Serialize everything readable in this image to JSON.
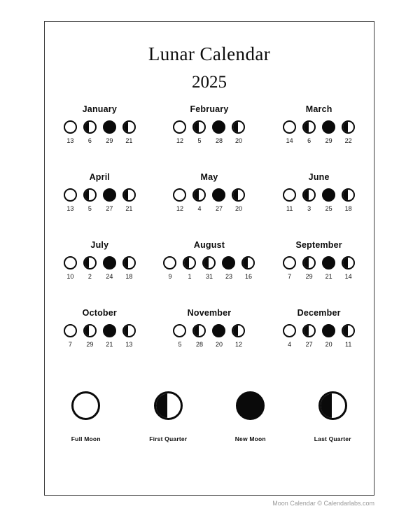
{
  "title": {
    "main": "Lunar Calendar",
    "year": "2025"
  },
  "months": [
    {
      "name": "January",
      "phases": [
        {
          "type": "full",
          "day": "13"
        },
        {
          "type": "first",
          "day": "6"
        },
        {
          "type": "new",
          "day": "29"
        },
        {
          "type": "last",
          "day": "21"
        }
      ]
    },
    {
      "name": "February",
      "phases": [
        {
          "type": "full",
          "day": "12"
        },
        {
          "type": "first",
          "day": "5"
        },
        {
          "type": "new",
          "day": "28"
        },
        {
          "type": "last",
          "day": "20"
        }
      ]
    },
    {
      "name": "March",
      "phases": [
        {
          "type": "full",
          "day": "14"
        },
        {
          "type": "first",
          "day": "6"
        },
        {
          "type": "new",
          "day": "29"
        },
        {
          "type": "last",
          "day": "22"
        }
      ]
    },
    {
      "name": "April",
      "phases": [
        {
          "type": "full",
          "day": "13"
        },
        {
          "type": "first",
          "day": "5"
        },
        {
          "type": "new",
          "day": "27"
        },
        {
          "type": "last",
          "day": "21"
        }
      ]
    },
    {
      "name": "May",
      "phases": [
        {
          "type": "full",
          "day": "12"
        },
        {
          "type": "first",
          "day": "4"
        },
        {
          "type": "new",
          "day": "27"
        },
        {
          "type": "last",
          "day": "20"
        }
      ]
    },
    {
      "name": "June",
      "phases": [
        {
          "type": "full",
          "day": "11"
        },
        {
          "type": "first",
          "day": "3"
        },
        {
          "type": "new",
          "day": "25"
        },
        {
          "type": "last",
          "day": "18"
        }
      ]
    },
    {
      "name": "July",
      "phases": [
        {
          "type": "full",
          "day": "10"
        },
        {
          "type": "first",
          "day": "2"
        },
        {
          "type": "new",
          "day": "24"
        },
        {
          "type": "last",
          "day": "18"
        }
      ]
    },
    {
      "name": "August",
      "phases": [
        {
          "type": "full",
          "day": "9"
        },
        {
          "type": "first",
          "day": "1"
        },
        {
          "type": "first",
          "day": "31"
        },
        {
          "type": "new",
          "day": "23"
        },
        {
          "type": "last",
          "day": "16"
        }
      ]
    },
    {
      "name": "September",
      "phases": [
        {
          "type": "full",
          "day": "7"
        },
        {
          "type": "first",
          "day": "29"
        },
        {
          "type": "new",
          "day": "21"
        },
        {
          "type": "last",
          "day": "14"
        }
      ]
    },
    {
      "name": "October",
      "phases": [
        {
          "type": "full",
          "day": "7"
        },
        {
          "type": "first",
          "day": "29"
        },
        {
          "type": "new",
          "day": "21"
        },
        {
          "type": "last",
          "day": "13"
        }
      ]
    },
    {
      "name": "November",
      "phases": [
        {
          "type": "full",
          "day": "5"
        },
        {
          "type": "first",
          "day": "28"
        },
        {
          "type": "new",
          "day": "20"
        },
        {
          "type": "last",
          "day": "12"
        }
      ]
    },
    {
      "name": "December",
      "phases": [
        {
          "type": "full",
          "day": "4"
        },
        {
          "type": "first",
          "day": "27"
        },
        {
          "type": "new",
          "day": "20"
        },
        {
          "type": "last",
          "day": "11"
        }
      ]
    }
  ],
  "legend": [
    {
      "type": "full",
      "label": "Full Moon"
    },
    {
      "type": "first",
      "label": "First Quarter"
    },
    {
      "type": "new",
      "label": "New Moon"
    },
    {
      "type": "last",
      "label": "Last Quarter"
    }
  ],
  "footer": {
    "credit": "Moon Calendar © Calendarlabs.com"
  },
  "colors": {
    "ink": "#0a0a0a",
    "page": "#ffffff",
    "border": "#3a3a3a",
    "footer_text": "#9a9a9a"
  }
}
